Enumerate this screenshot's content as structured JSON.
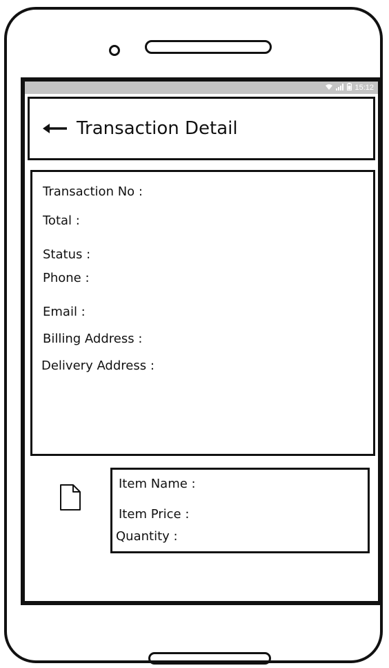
{
  "status_bar": {
    "wifi_icon": "wifi-icon",
    "signal_icon": "signal-icon",
    "battery_icon": "battery-icon",
    "time": "15:12"
  },
  "header": {
    "back_icon": "arrow-left-icon",
    "title": "Transaction Detail"
  },
  "details": {
    "transaction_no": "Transaction No :",
    "total": "Total :",
    "status": "Status :",
    "phone": "Phone :",
    "email": "Email :",
    "billing_address": "Billing Address :",
    "delivery_address": "Delivery Address :"
  },
  "item": {
    "icon": "document-icon",
    "name": "Item Name :",
    "price": "Item Price :",
    "quantity": "Quantity :"
  }
}
